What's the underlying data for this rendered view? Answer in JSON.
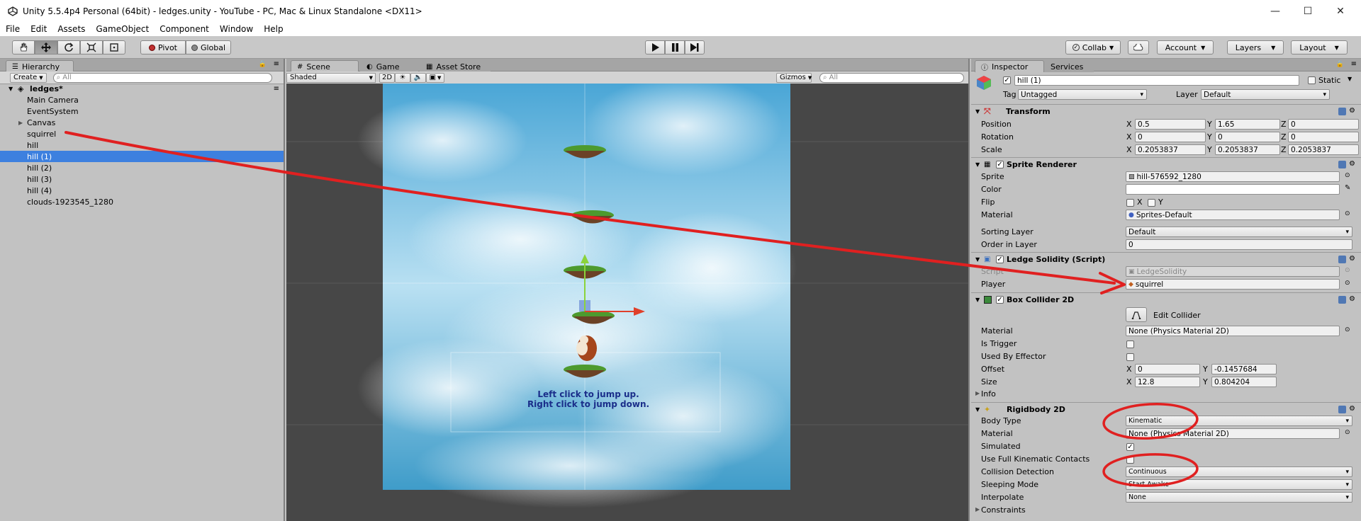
{
  "window": {
    "title": "Unity 5.5.4p4 Personal (64bit) - ledges.unity - YouTube - PC, Mac & Linux Standalone <DX11>",
    "minimize": "—",
    "maximize": "☐",
    "close": "✕"
  },
  "menu": [
    "File",
    "Edit",
    "Assets",
    "GameObject",
    "Component",
    "Window",
    "Help"
  ],
  "toolbar": {
    "pivot": "Pivot",
    "global": "Global",
    "collab": "Collab",
    "account": "Account",
    "layers": "Layers",
    "layout": "Layout"
  },
  "hierarchy": {
    "tab": "Hierarchy",
    "create": "Create",
    "search_placeholder": "All",
    "scene": "ledges*",
    "items": [
      "Main Camera",
      "EventSystem",
      "Canvas",
      "squirrel",
      "hill",
      "hill (1)",
      "hill (2)",
      "hill (3)",
      "hill (4)",
      "clouds-1923545_1280"
    ]
  },
  "scene_panel": {
    "tabs": [
      "Scene",
      "Game",
      "Asset Store"
    ],
    "shading": "Shaded",
    "mode_2d": "2D",
    "gizmos": "Gizmos",
    "search_placeholder": "All",
    "game_text_1": "Left click to jump up.",
    "game_text_2": "Right click to jump down."
  },
  "inspector": {
    "tabs": [
      "Inspector",
      "Services"
    ],
    "object_name": "hill (1)",
    "static_label": "Static",
    "tag_label": "Tag",
    "tag_value": "Untagged",
    "layer_label": "Layer",
    "layer_value": "Default",
    "transform": {
      "title": "Transform",
      "position_label": "Position",
      "rotation_label": "Rotation",
      "scale_label": "Scale",
      "position": [
        "0.5",
        "1.65",
        "0"
      ],
      "rotation": [
        "0",
        "0",
        "0"
      ],
      "scale": [
        "0.2053837",
        "0.2053837",
        "0.2053837"
      ]
    },
    "sprite_renderer": {
      "title": "Sprite Renderer",
      "sprite_label": "Sprite",
      "sprite_value": "hill-576592_1280",
      "color_label": "Color",
      "flip_label": "Flip",
      "flip_x": "X",
      "flip_y": "Y",
      "material_label": "Material",
      "material_value": "Sprites-Default",
      "sorting_layer_label": "Sorting Layer",
      "sorting_layer_value": "Default",
      "order_label": "Order in Layer",
      "order_value": "0"
    },
    "ledge_solidity": {
      "title": "Ledge Solidity (Script)",
      "script_label": "Script",
      "script_value": "LedgeSolidity",
      "player_label": "Player",
      "player_value": "squirrel"
    },
    "box_collider": {
      "title": "Box Collider 2D",
      "edit_collider": "Edit Collider",
      "material_label": "Material",
      "material_value": "None (Physics Material 2D)",
      "is_trigger_label": "Is Trigger",
      "used_by_effector_label": "Used By Effector",
      "offset_label": "Offset",
      "offset": [
        "0",
        "-0.1457684"
      ],
      "size_label": "Size",
      "size": [
        "12.8",
        "0.804204"
      ],
      "info_label": "Info"
    },
    "rigidbody": {
      "title": "Rigidbody 2D",
      "body_type_label": "Body Type",
      "body_type_value": "Kinematic",
      "material_label": "Material",
      "material_value": "None (Physics Material 2D)",
      "simulated_label": "Simulated",
      "full_kinematic_label": "Use Full Kinematic Contacts",
      "collision_label": "Collision Detection",
      "collision_value": "Continuous",
      "sleeping_label": "Sleeping Mode",
      "sleeping_value": "Start Awake",
      "interpolate_label": "Interpolate",
      "interpolate_value": "None",
      "constraints_label": "Constraints"
    }
  },
  "axis": {
    "x": "X",
    "y": "Y",
    "z": "Z"
  },
  "colors": {
    "selection": "#3d80df",
    "annotation_red": "#e02020",
    "panel_bg": "#c2c2c2",
    "scene_bg": "#474747"
  }
}
